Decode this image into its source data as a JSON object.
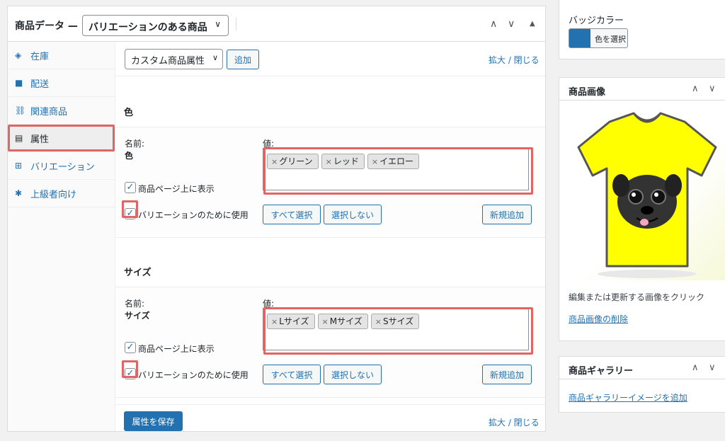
{
  "product_data": {
    "title": "商品データ —",
    "type_selected": "バリエーションのある商品",
    "controls": {
      "up": "∧",
      "down": "∨",
      "toggle": "▲"
    },
    "tabs": [
      {
        "label": "在庫",
        "icon": "diamond-tag-icon",
        "glyph": "◈"
      },
      {
        "label": "配送",
        "icon": "truck-icon",
        "glyph": "■"
      },
      {
        "label": "関連商品",
        "icon": "link-icon",
        "glyph": "⛓"
      },
      {
        "label": "属性",
        "icon": "table-icon",
        "glyph": "▤"
      },
      {
        "label": "バリエーション",
        "icon": "grid-icon",
        "glyph": "⊞"
      },
      {
        "label": "上級者向け",
        "icon": "gear-icon",
        "glyph": "✱"
      }
    ],
    "toolbar": {
      "attr_select": "カスタム商品属性",
      "add_button": "追加",
      "expand_collapse": "拡大 / 閉じる"
    },
    "attributes": [
      {
        "header": "色",
        "name_label": "名前:",
        "name_value": "色",
        "values_label": "値:",
        "values": [
          "グリーン",
          "レッド",
          "イエロー"
        ],
        "visible_label": "商品ページ上に表示",
        "visible_checked": true,
        "variation_label": "バリエーションのために使用",
        "variation_checked": true,
        "select_all": "すべて選択",
        "select_none": "選択しない",
        "add_new": "新規追加"
      },
      {
        "header": "サイズ",
        "name_label": "名前:",
        "name_value": "サイズ",
        "values_label": "値:",
        "values": [
          "Lサイズ",
          "Mサイズ",
          "Sサイズ"
        ],
        "visible_label": "商品ページ上に表示",
        "visible_checked": true,
        "variation_label": "バリエーションのために使用",
        "variation_checked": true,
        "select_all": "すべて選択",
        "select_none": "選択しない",
        "add_new": "新規追加"
      }
    ],
    "footer": {
      "save_button": "属性を保存",
      "expand_collapse": "拡大 / 閉じる"
    }
  },
  "badge_color": {
    "label": "バッジカラー",
    "button": "色を選択",
    "swatch_color": "#2271b1"
  },
  "product_image": {
    "title": "商品画像",
    "hint": "編集または更新する画像をクリック",
    "remove_link": "商品画像の削除",
    "shirt_color": "#ffff00"
  },
  "gallery": {
    "title": "商品ギャラリー",
    "add_link": "商品ギャラリーイメージを追加"
  },
  "colors": {
    "accent": "#2271b1",
    "highlight": "#e06666"
  }
}
